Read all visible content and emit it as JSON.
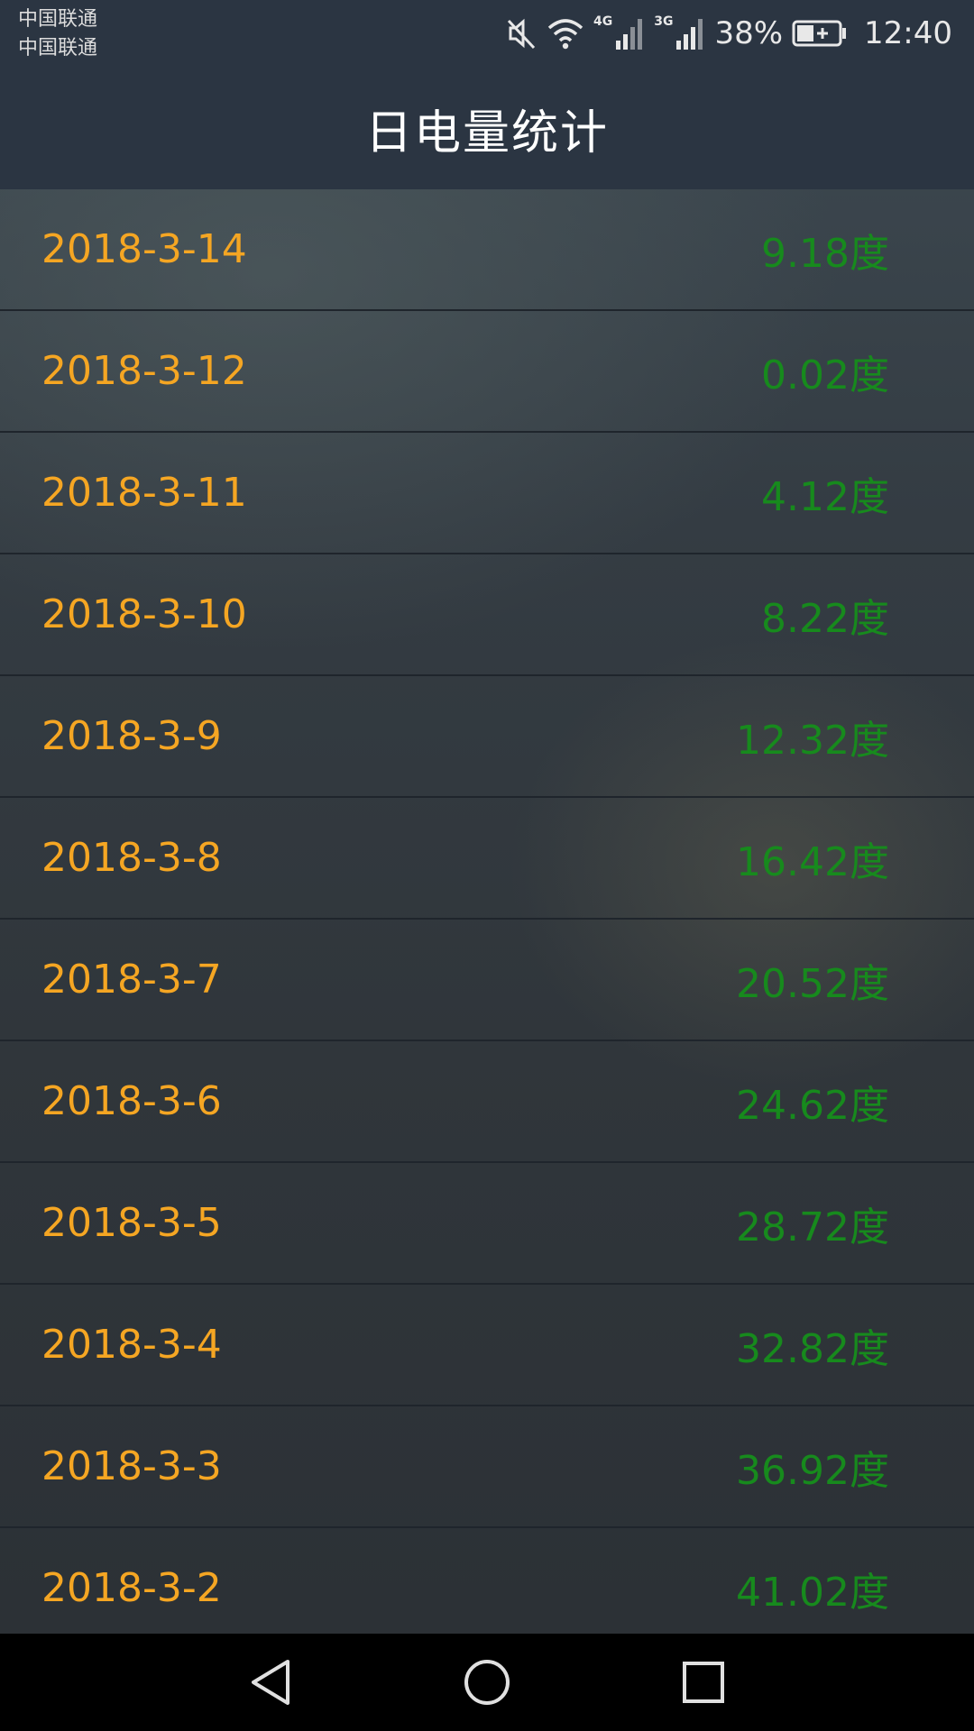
{
  "status_bar": {
    "carrier_1": "中国联通",
    "carrier_2": "中国联通",
    "net_1": "4G",
    "net_2": "3G",
    "battery_percent": "38%",
    "time": "12:40",
    "icons": [
      "mute-icon",
      "wifi-icon",
      "signal-4g-icon",
      "signal-3g-icon",
      "battery-charging-icon"
    ]
  },
  "header": {
    "title": "日电量统计"
  },
  "records": [
    {
      "date": "2018-3-14",
      "value": "9.18度"
    },
    {
      "date": "2018-3-12",
      "value": "0.02度"
    },
    {
      "date": "2018-3-11",
      "value": "4.12度"
    },
    {
      "date": "2018-3-10",
      "value": "8.22度"
    },
    {
      "date": "2018-3-9",
      "value": "12.32度"
    },
    {
      "date": "2018-3-8",
      "value": "16.42度"
    },
    {
      "date": "2018-3-7",
      "value": "20.52度"
    },
    {
      "date": "2018-3-6",
      "value": "24.62度"
    },
    {
      "date": "2018-3-5",
      "value": "28.72度"
    },
    {
      "date": "2018-3-4",
      "value": "32.82度"
    },
    {
      "date": "2018-3-3",
      "value": "36.92度"
    },
    {
      "date": "2018-3-2",
      "value": "41.02度"
    }
  ],
  "nav_bar": {
    "buttons": [
      "back-icon",
      "home-icon",
      "recents-icon"
    ]
  },
  "colors": {
    "date_text": "#f5a623",
    "value_text": "#178a1d",
    "bar_background": "#2b3542"
  }
}
